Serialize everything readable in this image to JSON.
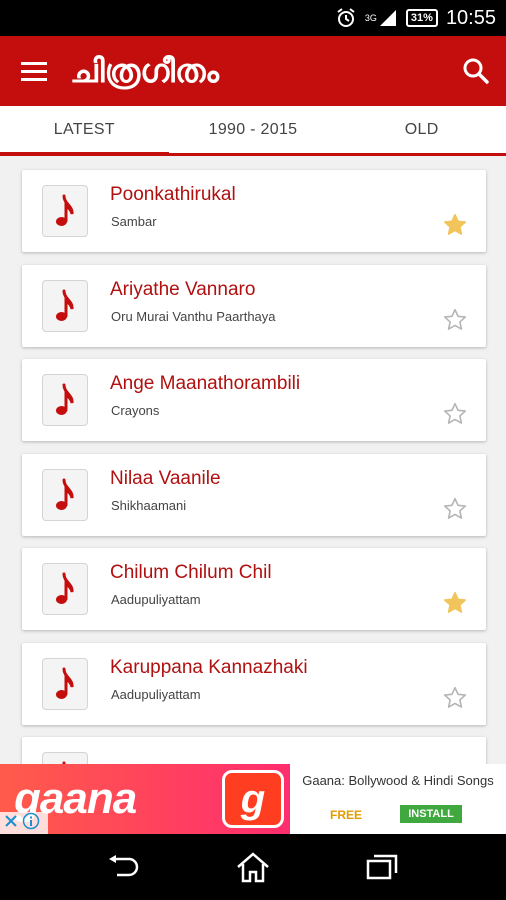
{
  "status": {
    "battery": "31%",
    "network": "3G",
    "time": "10:55"
  },
  "app": {
    "title": "ചിത്രഗീതം"
  },
  "tabs": [
    {
      "label": "LATEST",
      "active": true
    },
    {
      "label": "1990 - 2015",
      "active": false
    },
    {
      "label": "OLD",
      "active": false
    }
  ],
  "songs": [
    {
      "title": "Poonkathirukal",
      "subtitle": "Sambar",
      "favorite": true
    },
    {
      "title": "Ariyathe Vannaro",
      "subtitle": "Oru Murai Vanthu Paarthaya",
      "favorite": false
    },
    {
      "title": "Ange Maanathorambili",
      "subtitle": "Crayons",
      "favorite": false
    },
    {
      "title": "Nilaa Vaanile",
      "subtitle": "Shikhaamani",
      "favorite": false
    },
    {
      "title": "Chilum Chilum Chil",
      "subtitle": "Aadupuliyattam",
      "favorite": true
    },
    {
      "title": "Karuppana Kannazhaki",
      "subtitle": "Aadupuliyattam",
      "favorite": false
    },
    {
      "title": "",
      "subtitle": "",
      "favorite": false
    }
  ],
  "ad": {
    "brand": "gaana",
    "logo_letter": "g",
    "title": "Gaana: Bollywood & Hindi Songs",
    "price": "FREE",
    "install": "INSTALL"
  },
  "colors": {
    "primary": "#c40d0d",
    "star_filled": "#f2c55c",
    "star_empty": "#b5b5b5"
  },
  "icons": {
    "menu": "menu-icon",
    "search": "search-icon",
    "music": "music-note-icon",
    "star": "star-icon",
    "back": "back-icon",
    "home": "home-icon",
    "recents": "recents-icon"
  }
}
